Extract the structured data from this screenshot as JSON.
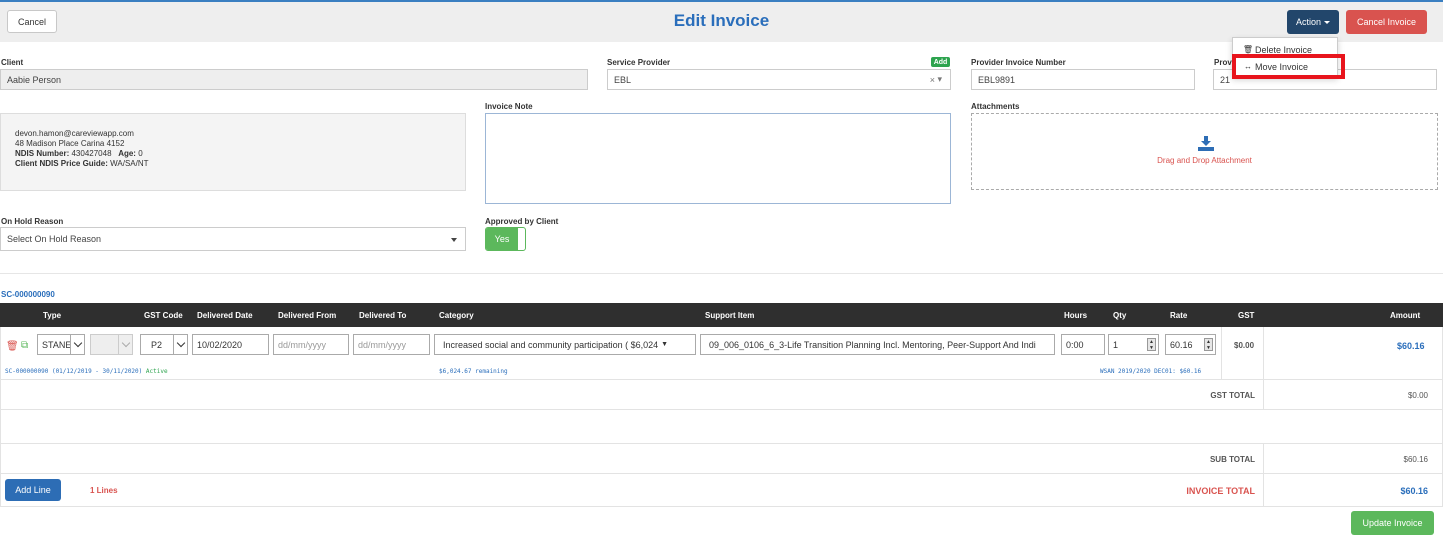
{
  "header": {
    "cancel_label": "Cancel",
    "title": "Edit Invoice",
    "action_label": "Action",
    "cancel_invoice_label": "Cancel Invoice"
  },
  "action_menu": {
    "items": [
      {
        "icon": "trash-icon",
        "label": "Delete Invoice"
      },
      {
        "icon": "arrows-horizontal-icon",
        "label": "Move Invoice"
      }
    ]
  },
  "client": {
    "label": "Client",
    "value": "Aabie Person",
    "email": "devon.hamon@careviewapp.com",
    "address": "48 Madison Place Carina 4152",
    "ndis_label": "NDIS Number:",
    "ndis_number": "430427048",
    "age_label": "Age:",
    "age": "0",
    "price_guide_label": "Client NDIS Price Guide:",
    "price_guide": "WA/SA/NT"
  },
  "service_provider": {
    "label": "Service Provider",
    "add_label": "Add",
    "value": "EBL",
    "clear_symbol": "×"
  },
  "provider_invoice": {
    "number_label": "Provider Invoice Number",
    "number_value": "EBL9891",
    "date_label_partial": "Prov",
    "date_value_partial": "21"
  },
  "invoice_note": {
    "label": "Invoice Note",
    "value": ""
  },
  "attachments": {
    "label": "Attachments",
    "drop_text": "Drag and Drop Attachment"
  },
  "on_hold": {
    "label": "On Hold Reason",
    "value": "Select On Hold Reason"
  },
  "approved": {
    "label": "Approved by Client",
    "value": "Yes"
  },
  "service_contract": "SC-000000090",
  "table": {
    "headers": {
      "type": "Type",
      "gst_code": "GST Code",
      "delivered_date": "Delivered Date",
      "delivered_from": "Delivered From",
      "delivered_to": "Delivered To",
      "category": "Category",
      "support_item": "Support Item",
      "hours": "Hours",
      "qty": "Qty",
      "rate": "Rate",
      "gst": "GST",
      "amount": "Amount"
    },
    "row": {
      "type": "STANE",
      "gst_code": "P2",
      "delivered_date": "10/02/2020",
      "delivered_from_placeholder": "dd/mm/yyyy",
      "delivered_to_placeholder": "dd/mm/yyyy",
      "category": "Increased social and community participation ( $6,024",
      "support_item": "09_006_0106_6_3-Life Transition Planning Incl. Mentoring, Peer-Support And Indi",
      "hours": "0:00",
      "qty": "1",
      "rate": "60.16",
      "gst": "$0.00",
      "amount": "$60.16",
      "meta_contract": "SC-000000090 (01/12/2019 - 30/11/2020)",
      "meta_status": "Active",
      "meta_remaining": "$6,024.67 remaining",
      "meta_price": "WSAN 2019/2020 DEC01: $60.16"
    }
  },
  "totals": {
    "gst_total_label": "GST TOTAL",
    "gst_total": "$0.00",
    "sub_total_label": "SUB TOTAL",
    "sub_total": "$60.16",
    "invoice_total_label": "INVOICE TOTAL",
    "invoice_total": "$60.16"
  },
  "footer": {
    "add_line_label": "Add Line",
    "lines_count": "1 Lines",
    "update_label": "Update Invoice"
  },
  "colors": {
    "title_blue": "#2a6ebb",
    "action_navy": "#22466b",
    "danger_red": "#d9534f",
    "success_green": "#5cb85c",
    "highlight_red": "#e8141c"
  }
}
